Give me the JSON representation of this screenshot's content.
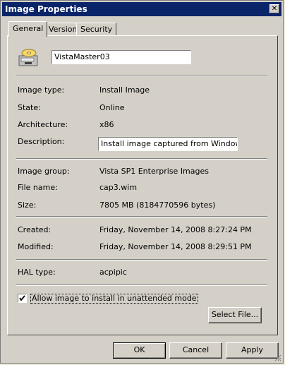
{
  "window": {
    "title": "Image Properties",
    "close_glyph": "✕"
  },
  "tabs": [
    {
      "label": "General"
    },
    {
      "label": "Version"
    },
    {
      "label": "Security"
    }
  ],
  "general": {
    "name": "VistaMaster03",
    "fields": {
      "image_type_label": "Image type:",
      "image_type_value": "Install Image",
      "state_label": "State:",
      "state_value": "Online",
      "architecture_label": "Architecture:",
      "architecture_value": "x86",
      "description_label": "Description:",
      "description_value": "Install image captured from Windows Vista",
      "image_group_label": "Image group:",
      "image_group_value": "Vista SP1 Enterprise Images",
      "file_name_label": "File name:",
      "file_name_value": "cap3.wim",
      "size_label": "Size:",
      "size_value": "7805 MB (8184770596 bytes)",
      "created_label": "Created:",
      "created_value": "Friday, November 14, 2008 8:27:24 PM",
      "modified_label": "Modified:",
      "modified_value": "Friday, November 14, 2008 8:29:51 PM",
      "hal_label": "HAL type:",
      "hal_value": "acpipic"
    },
    "unattended": {
      "label": "Allow image to install in unattended mode",
      "checked": true
    },
    "select_file_label": "Select File..."
  },
  "buttons": {
    "ok": "OK",
    "cancel": "Cancel",
    "apply": "Apply"
  },
  "icons": {
    "image": "disk-image-icon",
    "checkbox_mark": "check-icon"
  }
}
